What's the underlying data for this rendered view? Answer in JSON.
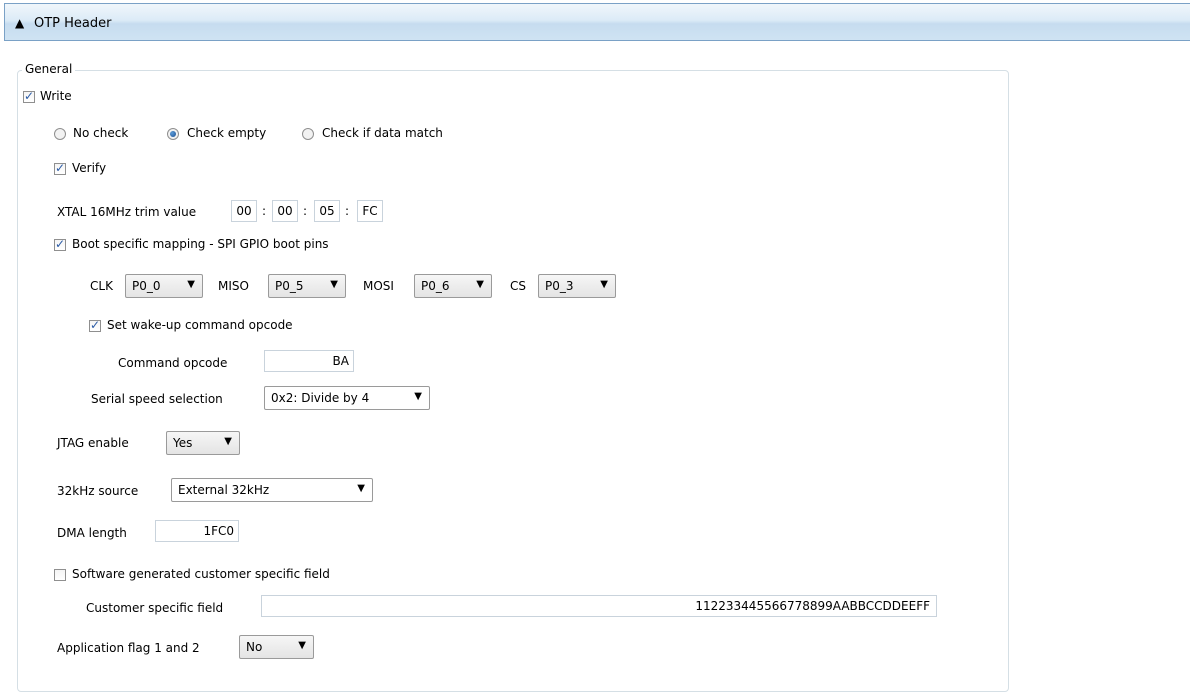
{
  "header": {
    "title": "OTP Header",
    "icon": "triangle-up-icon"
  },
  "general": {
    "legend": "General",
    "write": {
      "label": "Write",
      "checked": true
    },
    "check_mode": {
      "options": [
        "No check",
        "Check empty",
        "Check if data match"
      ],
      "selected": "Check empty"
    },
    "verify": {
      "label": "Verify",
      "checked": true
    },
    "xtal": {
      "label": "XTAL 16MHz trim value",
      "bytes": [
        "00",
        "00",
        "05",
        "FC"
      ],
      "separator": ":"
    },
    "boot_mapping": {
      "label": "Boot specific mapping - SPI GPIO boot pins",
      "checked": true
    },
    "pins": {
      "clk": {
        "label": "CLK",
        "value": "P0_0"
      },
      "miso": {
        "label": "MISO",
        "value": "P0_5"
      },
      "mosi": {
        "label": "MOSI",
        "value": "P0_6"
      },
      "cs": {
        "label": "CS",
        "value": "P0_3"
      }
    },
    "wakeup": {
      "label": "Set wake-up command opcode",
      "checked": true
    },
    "command_opcode": {
      "label": "Command opcode",
      "value": "BA"
    },
    "serial_speed": {
      "label": "Serial speed selection",
      "value": "0x2: Divide by 4"
    },
    "jtag": {
      "label": "JTAG enable",
      "value": "Yes"
    },
    "source_32k": {
      "label": "32kHz source",
      "value": "External 32kHz"
    },
    "dma_length": {
      "label": "DMA length",
      "value": "1FC0"
    },
    "sw_customer": {
      "label": "Software generated customer specific field",
      "checked": false
    },
    "customer_field": {
      "label": "Customer specific field",
      "value": "112233445566778899AABBCCDDEEFF"
    },
    "app_flag": {
      "label": "Application flag 1 and 2",
      "value": "No"
    }
  }
}
